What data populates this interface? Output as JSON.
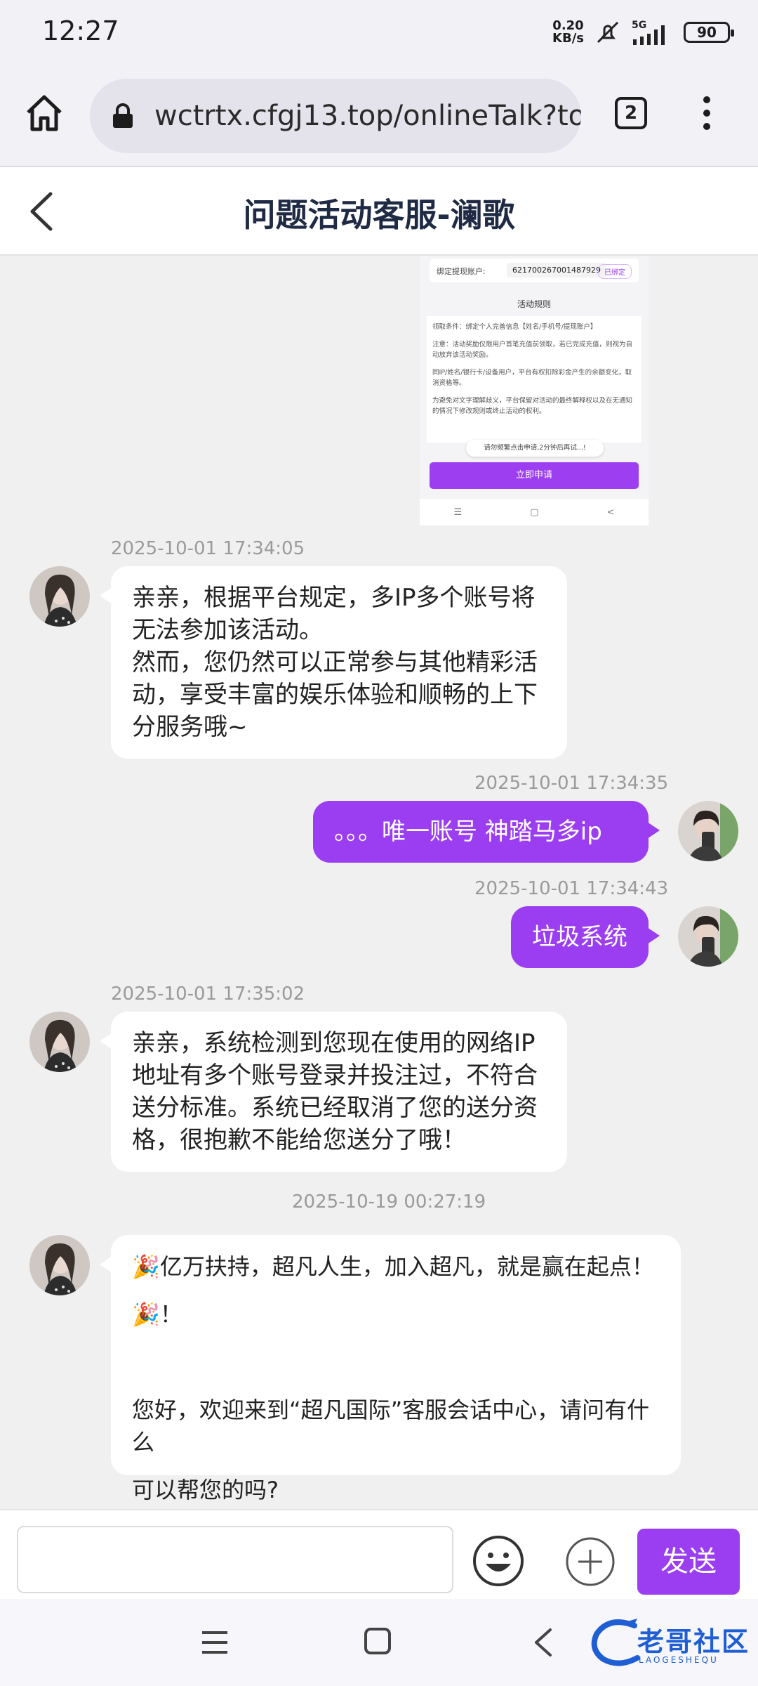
{
  "status_bar": {
    "time": "12:27",
    "net_speed_value": "0.20",
    "net_speed_unit": "KB/s",
    "network": "5G",
    "battery": "90"
  },
  "browser": {
    "url": "wctrtx.cfgj13.top/onlineTalk?to=",
    "tab_count": "2"
  },
  "chat": {
    "title": "问题活动客服-澜歌"
  },
  "screenshot": {
    "row_label": "绑定提现账户:",
    "row_value": "621700267001487929",
    "row_badge": "已绑定",
    "rules_title": "活动规则",
    "rules": [
      "领取条件：绑定个人完善信息【姓名/手机号/提现账户】",
      "注意：活动奖励仅限用户首笔充值前领取，若已完成充值，则视为自动放弃该活动奖励。",
      "同IP/姓名/银行卡/设备用户，平台有权扣除彩金产生的余额变化，取消资格等。",
      "为避免对文字理解歧义，平台保留对活动的最终解释权以及在无通知的情况下修改规则或终止活动的权利。"
    ],
    "toast": "请勿频繁点击申请,2分钟后再试...!",
    "apply_button": "立即申请"
  },
  "messages": [
    {
      "timestamp": "2025-10-01 17:34:05",
      "lines": [
        "亲亲，根据平台规定，多IP多个账号将",
        "无法参加该活动。",
        "然而，您仍然可以正常参与其他精彩活",
        "动，享受丰富的娱乐体验和顺畅的上下",
        "分服务哦~"
      ]
    },
    {
      "timestamp": "2025-10-01 17:34:35",
      "text": "。。。唯一账号 神踏马多ip"
    },
    {
      "timestamp": "2025-10-01 17:34:43",
      "text": "垃圾系统"
    },
    {
      "timestamp": "2025-10-01 17:35:02",
      "lines": [
        "亲亲，系统检测到您现在使用的网络IP",
        "地址有多个账号登录并投注过，不符合",
        "送分标准。系统已经取消了您的送分资",
        "格，很抱歉不能给您送分了哦！"
      ]
    },
    {
      "timestamp": "2025-10-19 00:27:19",
      "line1": "🎉亿万扶持，超凡人生，加入超凡，就是赢在起点！",
      "line2": "🎉！",
      "line3": "您好，欢迎来到“超凡国际”客服会话中心，请问有什么",
      "line4": "可以帮您的吗?"
    }
  ],
  "input": {
    "placeholder": "",
    "send_label": "发送"
  },
  "watermark": {
    "text": "老哥社区",
    "sub": "LAOGESHEQU"
  },
  "colors": {
    "accent": "#9b3df1",
    "background": "#f0f0f0"
  }
}
